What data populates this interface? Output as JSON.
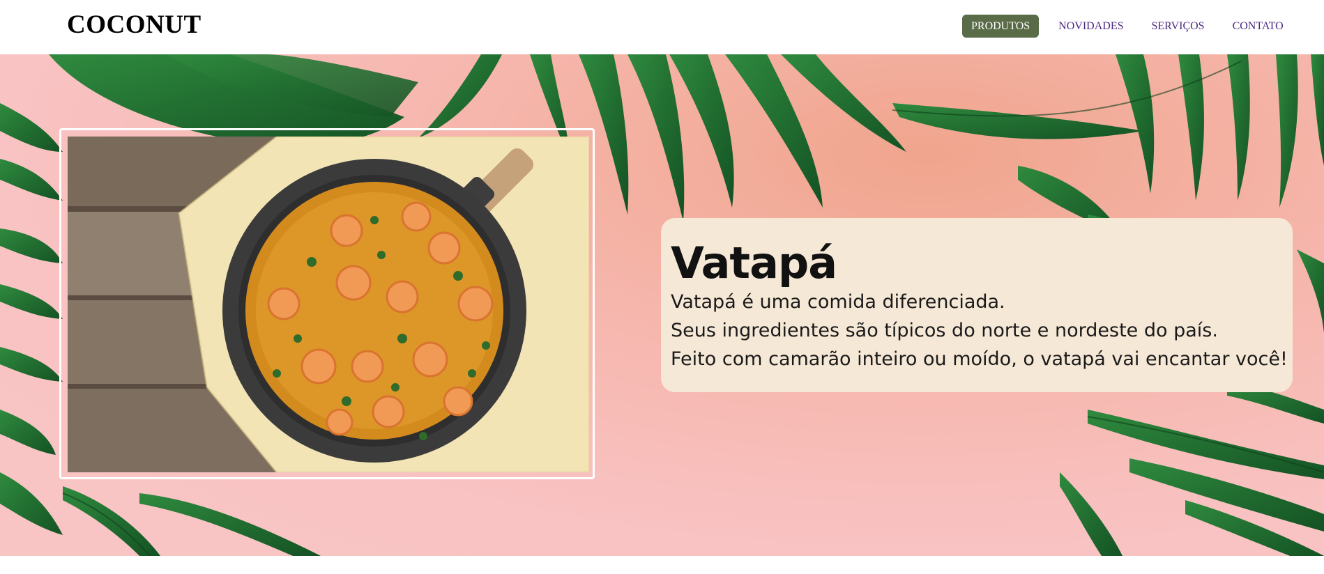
{
  "brand": {
    "logo": "COCONUT"
  },
  "nav": {
    "items": [
      {
        "label": "PRODUTOS",
        "active": true
      },
      {
        "label": "NOVIDADES",
        "active": false
      },
      {
        "label": "SERVIÇOS",
        "active": false
      },
      {
        "label": "CONTATO",
        "active": false
      }
    ]
  },
  "hero": {
    "image_alt": "vatapá-dish-photo",
    "title": "Vatapá",
    "lines": [
      "Vatapá é uma comida diferenciada.",
      "Seus ingredientes são típicos do norte e nordeste do país.",
      "Feito com camarão inteiro ou moído, o vatapá vai encantar você!"
    ]
  },
  "colors": {
    "nav_active_bg": "#5a6b48",
    "nav_link": "#4b2a82",
    "hero_bg": "#f8c4c4",
    "card_bg": "#f6e8d6",
    "leaf": "#1f6b2e"
  }
}
